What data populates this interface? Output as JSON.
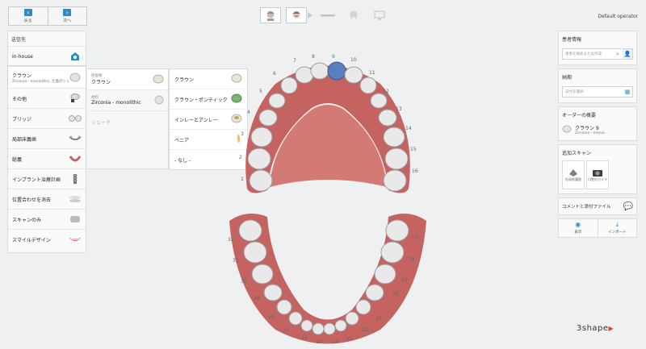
{
  "nav": {
    "back_label": "戻る",
    "forward_label": "次へ"
  },
  "header": {
    "operator": "Default operator"
  },
  "left": {
    "title": "送信先",
    "items": [
      {
        "label": "In-house",
        "sub": ""
      },
      {
        "label": "クラウン",
        "sub": "Zirconia - monolithic, 仕着のシェード"
      },
      {
        "label": "その他",
        "sub": ""
      },
      {
        "label": "ブリッジ",
        "sub": ""
      },
      {
        "label": "局部床義歯",
        "sub": ""
      },
      {
        "label": "総義",
        "sub": ""
      },
      {
        "label": "インプラント治療計画",
        "sub": ""
      },
      {
        "label": "位置合わせを消去",
        "sub": ""
      },
      {
        "label": "スキャンのみ",
        "sub": ""
      },
      {
        "label": "スマイルデザイン",
        "sub": ""
      }
    ]
  },
  "col2": {
    "rows": [
      {
        "caption": "修復物",
        "label": "クラウン"
      },
      {
        "caption": "材料",
        "label": "Zirconia - monolithic"
      },
      {
        "caption": "",
        "label": "シェード"
      }
    ]
  },
  "col3": {
    "rows": [
      {
        "label": "クラウン"
      },
      {
        "label": "クラウン・ポンティック"
      },
      {
        "label": "インレーとアンレー"
      },
      {
        "label": "ベニア"
      },
      {
        "label": "- なし -"
      }
    ]
  },
  "teeth": {
    "upper": [
      "1",
      "2",
      "3",
      "4",
      "5",
      "6",
      "7",
      "8",
      "9",
      "10",
      "11",
      "12",
      "13",
      "14",
      "15",
      "16"
    ],
    "lower": [
      "17",
      "18",
      "19",
      "20",
      "21",
      "22",
      "23",
      "24",
      "25",
      "26",
      "27",
      "28",
      "29",
      "30",
      "31",
      "32"
    ],
    "selected": "9"
  },
  "right": {
    "patient_title": "患者情報",
    "patient_placeholder": "患者を検索または作成",
    "deadline_title": "納期",
    "deadline_placeholder": "日付を選択",
    "summary_title": "オーダーの概要",
    "summary_item": "クラウン 9",
    "summary_sub": "Zirconia - monol...",
    "scan_title": "追加スキャン",
    "scan_buttons": [
      "形成前履歴",
      "口腔内カメラ"
    ],
    "attach_label": "コメントと添付ファイル",
    "view_label": "表示",
    "import_label": "インポート"
  },
  "logo": {
    "text": "3shape"
  },
  "colors": {
    "accent": "#2b8cc8",
    "gum": "#c4635f",
    "selected_tooth": "#5a7fc0"
  }
}
